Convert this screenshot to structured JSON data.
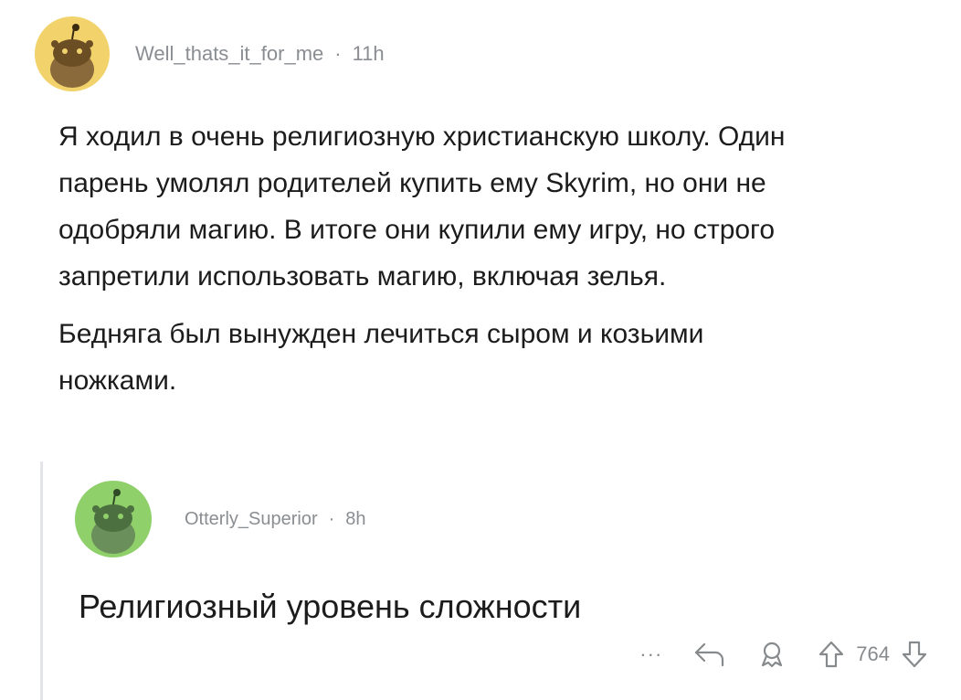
{
  "parent_comment": {
    "username": "Well_thats_it_for_me",
    "separator": "·",
    "time": "11h",
    "avatar_color": "#f2d26b",
    "paragraphs": [
      "Я ходил в очень религиозную христианскую школу. Один парень умолял родителей купить ему Skyrim, но они не одобряли магию. В итоге они купили ему игру, но строго запретили использовать магию, включая зелья.",
      "Бедняга был вынужден лечиться сыром и козьими ножками."
    ]
  },
  "reply_comment": {
    "username": "Otterly_Superior",
    "separator": "·",
    "time": "8h",
    "avatar_color": "#8fd06a",
    "text": "Религиозный уровень сложности",
    "actions": {
      "more_label": "···",
      "reply_icon": "reply-arrow-icon",
      "award_icon": "award-icon",
      "upvote_icon": "upvote-arrow-icon",
      "score": "764",
      "downvote_icon": "downvote-arrow-icon"
    }
  }
}
